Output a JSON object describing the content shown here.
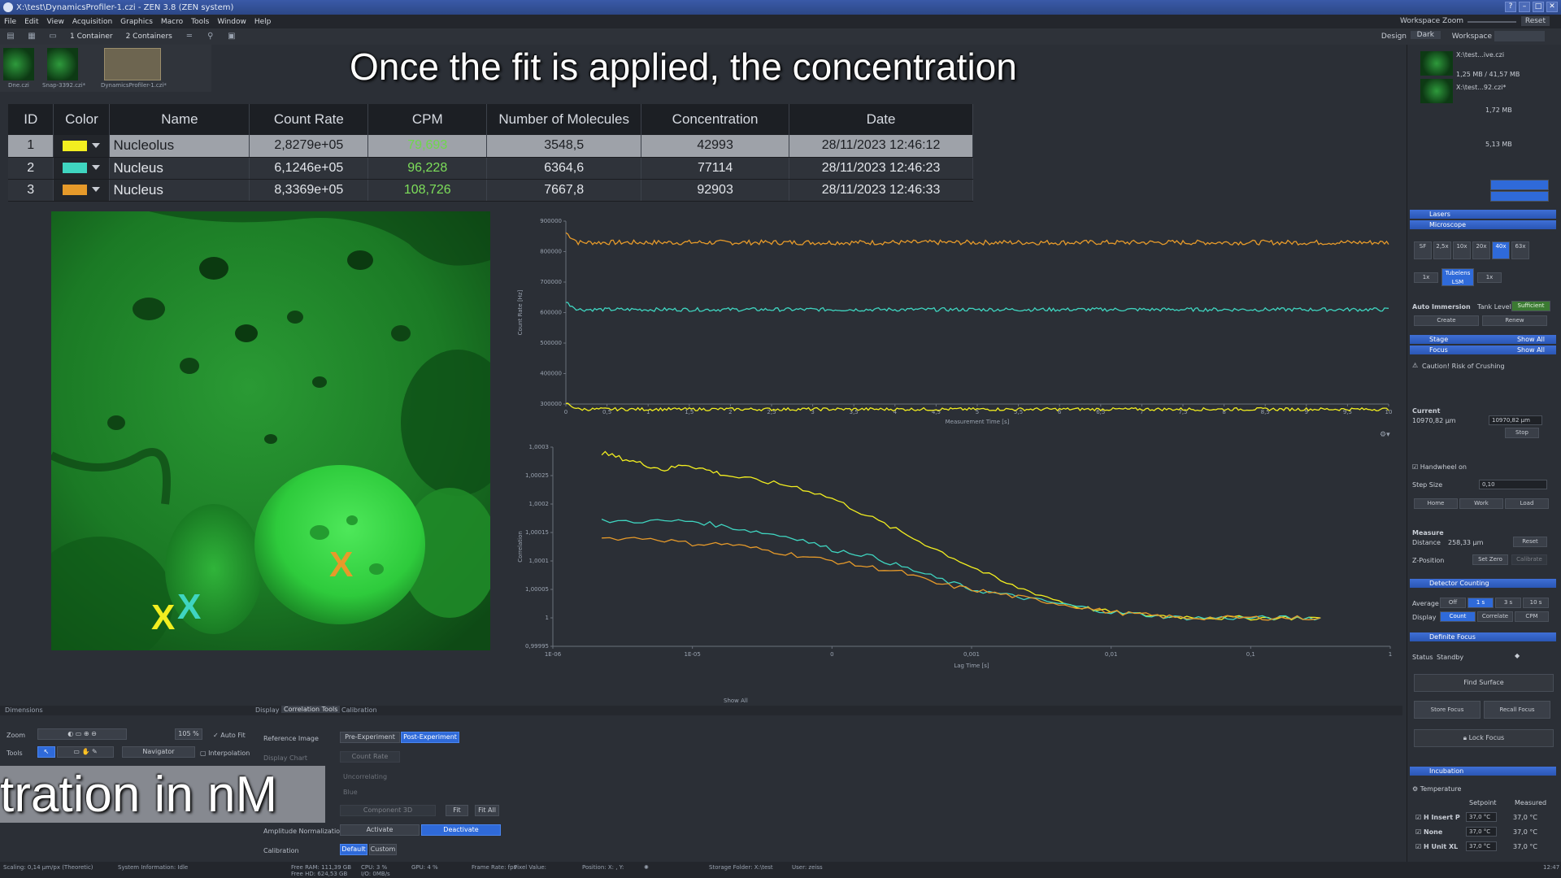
{
  "window": {
    "title": "X:\\test\\DynamicsProfiler-1.czi - ZEN 3.8 (ZEN system)"
  },
  "menu": [
    "File",
    "Edit",
    "View",
    "Acquisition",
    "Graphics",
    "Macro",
    "Tools",
    "Window",
    "Help"
  ],
  "workspace_zoom": {
    "label": "Workspace Zoom",
    "reset": "Reset"
  },
  "toolbar": {
    "container_1": "1 Container",
    "container_2": "2 Containers",
    "design_label": "Design",
    "design_value": "Dark",
    "workspace_label": "Workspace"
  },
  "thumbnails": [
    {
      "label": "Dne.czi"
    },
    {
      "label": "Snap-3392.czi*"
    },
    {
      "label": "DynamicsProfiler-1.czi*"
    }
  ],
  "subtitle_top": "Once the fit is applied, the concentration",
  "subtitle_bottom": "tration in nM",
  "table": {
    "headers": [
      "ID",
      "Color",
      "Name",
      "Count Rate",
      "CPM",
      "Number of Molecules",
      "Concentration",
      "Date"
    ],
    "rows": [
      {
        "id": "1",
        "color": "#f2ee20",
        "name": "Nucleolus",
        "count_rate": "2,8279e+05",
        "cpm": "79,693",
        "molecules": "3548,5",
        "concentration": "42993",
        "date": "28/11/2023 12:46:12"
      },
      {
        "id": "2",
        "color": "#3fd5c0",
        "name": "Nucleus",
        "count_rate": "6,1246e+05",
        "cpm": "96,228",
        "molecules": "6364,6",
        "concentration": "77114",
        "date": "28/11/2023 12:46:23"
      },
      {
        "id": "3",
        "color": "#e69a2a",
        "name": "Nucleus",
        "count_rate": "8,3369e+05",
        "cpm": "108,726",
        "molecules": "7667,8",
        "concentration": "92903",
        "date": "28/11/2023 12:46:33"
      }
    ]
  },
  "markers": [
    {
      "glyph": "X",
      "color": "#f2ee20"
    },
    {
      "glyph": "X",
      "color": "#3fd5c0"
    },
    {
      "glyph": "X",
      "color": "#e69a2a"
    }
  ],
  "chart_data": [
    {
      "type": "line",
      "xlabel": "Measurement Time [s]",
      "ylabel": "Count Rate [Hz]",
      "x_ticks": [
        "0",
        "0,5",
        "1",
        "1,5",
        "2",
        "2,5",
        "3",
        "3,5",
        "4",
        "4,5",
        "5",
        "5,5",
        "6",
        "6,5",
        "7",
        "7,5",
        "8",
        "8,5",
        "9",
        "9,5",
        "10"
      ],
      "y_ticks": [
        "300000",
        "400000",
        "500000",
        "600000",
        "700000",
        "800000",
        "900000"
      ],
      "xlim": [
        0,
        10
      ],
      "ylim": [
        300000,
        900000
      ],
      "series": [
        {
          "color": "#e69a2a",
          "mean": 830000,
          "noise": 8000
        },
        {
          "color": "#3fd5c0",
          "mean": 610000,
          "noise": 6000
        },
        {
          "color": "#f2ee20",
          "mean": 283000,
          "noise": 5000
        }
      ]
    },
    {
      "type": "line",
      "xlabel": "Lag Time [s]",
      "ylabel": "Correlation",
      "x_scale": "log",
      "x_ticks": [
        "1E-06",
        "1E-05",
        "0",
        "0,001",
        "0,01",
        "0,1",
        "1"
      ],
      "x_tick_exponents": [
        -6,
        -5,
        -4,
        -3,
        -2,
        -1,
        0
      ],
      "y_ticks": [
        "0,99995",
        "1",
        "1,00005",
        "1,0001",
        "1,00015",
        "1,0002",
        "1,00025",
        "1,0003"
      ],
      "xlim_log10": [
        -6,
        0
      ],
      "ylim": [
        0.99995,
        1.0003
      ],
      "series": [
        {
          "color": "#f2ee20",
          "x_log10": [
            -5.65,
            -5.5,
            -5.35,
            -5.2,
            -5.05,
            -4.9,
            -4.75,
            -4.5,
            -4.25,
            -4.0,
            -3.75,
            -3.5,
            -3.25,
            -3.0,
            -2.75,
            -2.5,
            -2.25,
            -2.0,
            -1.75,
            -1.5,
            -1.25,
            -1.0,
            -0.75,
            -0.5
          ],
          "y": [
            1.00029,
            1.00028,
            1.00027,
            1.00026,
            1.00027,
            1.00026,
            1.00025,
            1.00024,
            1.00023,
            1.00021,
            1.00018,
            1.00015,
            1.00012,
            1.00009,
            1.00006,
            1.00004,
            1.00002,
            1.00001,
            1.000005,
            1.000002,
            1.0,
            1.0,
            1.0,
            1.0
          ]
        },
        {
          "color": "#3fd5c0",
          "x_log10": [
            -5.65,
            -5.3,
            -5.0,
            -4.75,
            -4.5,
            -4.25,
            -4.0,
            -3.75,
            -3.5,
            -3.25,
            -3.0,
            -2.75,
            -2.5,
            -2.25,
            -2.0,
            -1.75,
            -1.5,
            -1.25,
            -1.0,
            -0.75,
            -0.5
          ],
          "y": [
            1.00017,
            1.00017,
            1.00017,
            1.00016,
            1.00015,
            1.00014,
            1.00012,
            1.00011,
            1.00009,
            1.00007,
            1.00005,
            1.00004,
            1.00003,
            1.00002,
            1.00001,
            1.000005,
            1.0,
            1.0,
            1.0,
            1.0,
            1.0
          ]
        },
        {
          "color": "#e69a2a",
          "x_log10": [
            -5.65,
            -5.3,
            -5.0,
            -4.75,
            -4.5,
            -4.25,
            -4.0,
            -3.75,
            -3.5,
            -3.25,
            -3.0,
            -2.75,
            -2.5,
            -2.25,
            -2.0,
            -1.75,
            -1.5,
            -1.25,
            -1.0,
            -0.75,
            -0.5
          ],
          "y": [
            1.00014,
            1.00014,
            1.00013,
            1.00013,
            1.00012,
            1.00011,
            1.0001,
            1.00009,
            1.00008,
            1.00006,
            1.00005,
            1.00004,
            1.00003,
            1.00002,
            1.00001,
            1.000005,
            1.0,
            1.0,
            1.0,
            1.0,
            1.0
          ]
        }
      ]
    }
  ],
  "show_all": "Show All",
  "bottom": {
    "tabs": [
      "Dimensions",
      "Display",
      "Correlation Tools",
      "Calibration"
    ],
    "zoom_label": "Zoom",
    "zoom_value": "105 %",
    "auto_fit": "Auto Fit",
    "tools_label": "Tools",
    "navigator": "Navigator",
    "interpolation": "Interpolation",
    "reference_image": "Reference Image",
    "pre_experiment": "Pre-Experiment",
    "post_experiment": "Post-Experiment",
    "display_chart": "Display Chart",
    "count_rate": "Count Rate",
    "amplitude_norm": "Amplitude Normalization",
    "activate": "Activate",
    "deactivate": "Deactivate",
    "calibration": "Calibration",
    "default": "Default",
    "custom": "Custom",
    "fit": "Fit",
    "fit_all": "Fit All",
    "component": "Component 3D",
    "uncorrelating": "Uncorrelating",
    "blue": "Blue"
  },
  "status": {
    "scaling": "Scaling: 0,14 µm/px (Theoretic)",
    "system_info": "System Information: Idle",
    "ram": "Free RAM: 111,39 GB",
    "hd": "Free HD: 624,53 GB",
    "cpu": "CPU: 3 %",
    "io": "I/O: 0MB/s",
    "gpu": "GPU: 4 %",
    "frame_rate": "Frame Rate: fps",
    "pixel_value": "Pixel Value:",
    "position": "Position: X: , Y:",
    "storage": "Storage Folder: X:\\test",
    "user": "User: zeiss",
    "time": "12:47"
  },
  "right": {
    "files": [
      {
        "name": "X:\\test...ive.czi",
        "size": "1,25 MB / 41,57 MB"
      },
      {
        "name": "X:\\test...92.czi*",
        "size": "1,72 MB"
      },
      {
        "name": "",
        "size": "5,13 MB"
      }
    ],
    "lasers": "Lasers",
    "microscope": "Microscope",
    "objectives": [
      "SF",
      "2,5x",
      "10x",
      "20x",
      "40x",
      "63x"
    ],
    "tubelens": "Tubelens LSM",
    "one_x": "1x",
    "auto_immersion": "Auto Immersion",
    "tank_level": "Tank Level",
    "sufficient": "Sufficient",
    "create": "Create",
    "renew": "Renew",
    "stage": "Stage",
    "focus": "Focus",
    "show_all": "Show All",
    "caution": "Caution! Risk of Crushing",
    "current": "Current",
    "current_value": "10970,82 µm",
    "target_value": "10970,82 µm",
    "stop": "Stop",
    "handwheel": "Handwheel on",
    "step_size": "Step Size",
    "step_value": "0,10",
    "home": "Home",
    "work": "Work",
    "load": "Load",
    "measure": "Measure",
    "distance": "Distance",
    "distance_value": "258,33 µm",
    "reset": "Reset",
    "z_position": "Z-Position",
    "set_zero": "Set Zero",
    "calibrate": "Calibrate",
    "detector_counting": "Detector Counting",
    "average": "Average",
    "avg_opts": [
      "Off",
      "1 s",
      "3 s",
      "10 s"
    ],
    "display": "Display",
    "disp_opts": [
      "Count",
      "Correlate",
      "CPM"
    ],
    "definite_focus": "Definite Focus",
    "status_label": "Status",
    "status_value": "Standby",
    "find_surface": "Find Surface",
    "store_focus": "Store Focus",
    "recall_focus": "Recall Focus",
    "lock_focus": "Lock Focus",
    "incubation": "Incubation",
    "temperature": "Temperature",
    "setpoint": "Setpoint",
    "measured": "Measured",
    "temps": [
      {
        "name": "H Insert P",
        "set": "37,0 °C",
        "meas": "37,0 °C"
      },
      {
        "name": "None",
        "set": "37,0 °C",
        "meas": "37,0 °C"
      },
      {
        "name": "H Unit XL",
        "set": "37,0 °C",
        "meas": "37,0 °C"
      }
    ]
  }
}
